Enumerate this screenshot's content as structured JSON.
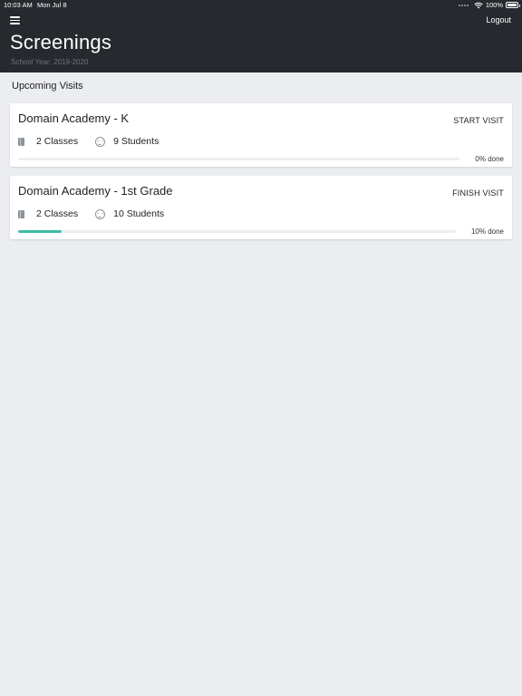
{
  "status_bar": {
    "time": "10:03 AM",
    "date": "Mon Jul 8",
    "battery": "100%"
  },
  "header": {
    "title": "Screenings",
    "subtitle": "School Year: 2019-2020",
    "logout_label": "Logout",
    "menu_icon": "hamburger-menu-icon",
    "background_color": "#262a2f"
  },
  "section_title": "Upcoming Visits",
  "visits": [
    {
      "name": "Domain Academy - K",
      "action_label": "START VISIT",
      "classes": "2 Classes",
      "students": "9 Students",
      "progress_label": "0% done",
      "progress": 0
    },
    {
      "name": "Domain Academy - 1st Grade",
      "action_label": "FINISH VISIT",
      "classes": "2 Classes",
      "students": "10 Students",
      "progress_label": "10% done",
      "progress": 0.1
    }
  ],
  "colors": {
    "accent": "#3dbda5",
    "page_background": "#ebedf0"
  }
}
